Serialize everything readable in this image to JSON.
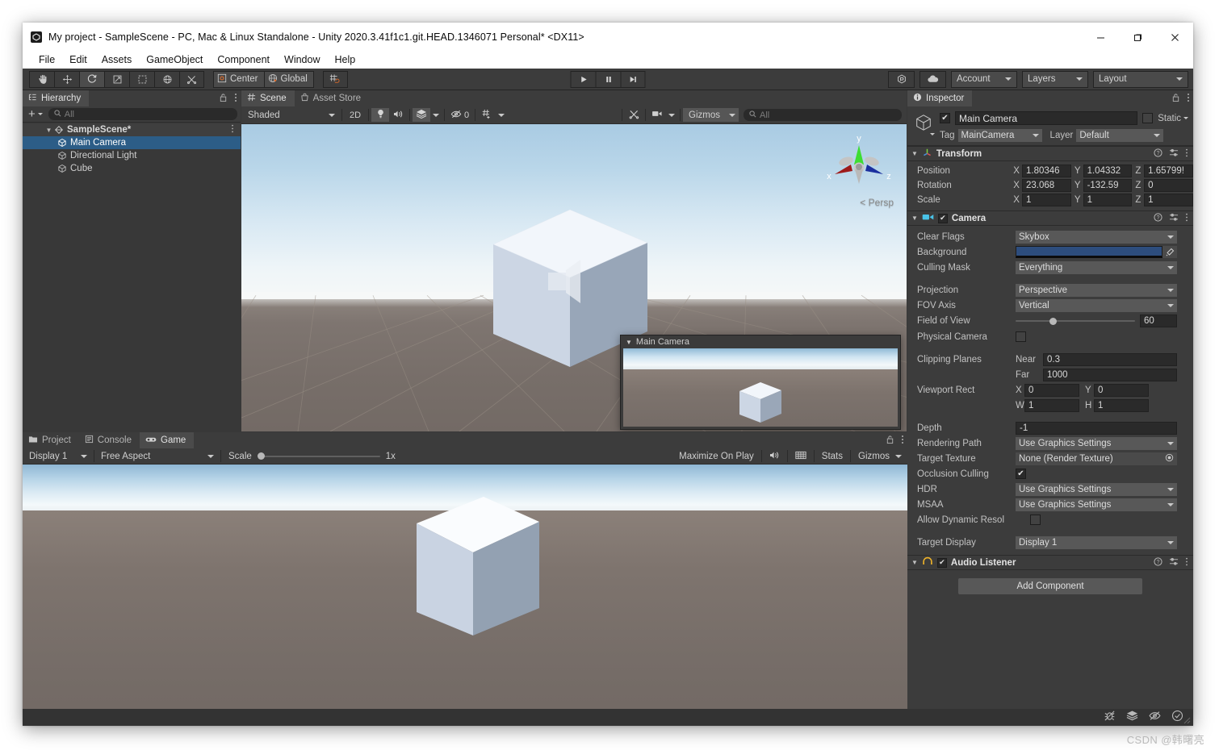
{
  "window": {
    "title": "My project - SampleScene - PC, Mac & Linux Standalone - Unity 2020.3.41f1c1.git.HEAD.1346071 Personal* <DX11>",
    "minimize_label": "Minimize",
    "maximize_label": "Maximize",
    "close_label": "Close"
  },
  "menubar": {
    "items": [
      "File",
      "Edit",
      "Assets",
      "GameObject",
      "Component",
      "Window",
      "Help"
    ]
  },
  "toolbar": {
    "tools": [
      {
        "name": "hand-tool",
        "glyph": "✋"
      },
      {
        "name": "move-tool",
        "glyph": "✥"
      },
      {
        "name": "rotate-tool",
        "glyph": "↺"
      },
      {
        "name": "scale-tool",
        "glyph": "⤢"
      },
      {
        "name": "rect-tool",
        "glyph": "⬚"
      },
      {
        "name": "transform-tool",
        "glyph": "⊕"
      },
      {
        "name": "custom-editor-tool",
        "glyph": "✂"
      }
    ],
    "pivot_label": "Center",
    "handle_label": "Global",
    "grid_snap_label": "Grid Snapping",
    "play_label": "Play",
    "pause_label": "Pause",
    "step_label": "Step",
    "collab_label": "Collab",
    "cloud_label": "Services",
    "account_label": "Account",
    "layers_label": "Layers",
    "layout_label": "Layout"
  },
  "hierarchy": {
    "tab_label": "Hierarchy",
    "add_label": "+",
    "search_placeholder": "All",
    "search_value": "",
    "items": [
      {
        "label": "SampleScene*",
        "depth": 0,
        "type": "scene",
        "expanded": true,
        "selected": false
      },
      {
        "label": "Main Camera",
        "depth": 1,
        "type": "gameobject",
        "selected": true
      },
      {
        "label": "Directional Light",
        "depth": 1,
        "type": "gameobject",
        "selected": false
      },
      {
        "label": "Cube",
        "depth": 1,
        "type": "gameobject",
        "selected": false
      }
    ]
  },
  "scene": {
    "tabs": [
      {
        "label": "Scene",
        "active": true,
        "icon": "grid-icon"
      },
      {
        "label": "Asset Store",
        "active": false,
        "icon": "store-icon"
      }
    ],
    "draw_mode": "Shaded",
    "toggle_2d": "2D",
    "lighting_label": "Lighting",
    "audio_label": "Audio",
    "fx_label": "Effects",
    "hidden_count": "0",
    "grid_label": "Grid",
    "tools_label": "Scene Tools",
    "camera_label": "Scene Camera",
    "gizmos_label": "Gizmos",
    "search_placeholder": "All",
    "search_value": "",
    "persp_label": "< Persp",
    "axis_labels": {
      "x": "x",
      "y": "y",
      "z": "z"
    },
    "preview_title": "Main Camera"
  },
  "game": {
    "tabs": [
      {
        "label": "Project",
        "active": false,
        "icon": "folder-icon"
      },
      {
        "label": "Console",
        "active": false,
        "icon": "console-icon"
      },
      {
        "label": "Game",
        "active": true,
        "icon": "gamepad-icon"
      }
    ],
    "display": "Display 1",
    "aspect": "Free Aspect",
    "scale_label": "Scale",
    "scale_value": "1x",
    "maximize_label": "Maximize On Play",
    "mute_label": "Mute Audio",
    "stats_label": "Stats",
    "gizmos_label": "Gizmos"
  },
  "inspector": {
    "tab_label": "Inspector",
    "object_name": "Main Camera",
    "object_enabled": true,
    "static_label": "Static",
    "static_checked": false,
    "tag_label": "Tag",
    "tag_value": "MainCamera",
    "layer_label": "Layer",
    "layer_value": "Default",
    "components": [
      {
        "name": "Transform",
        "icon": "transform-icon",
        "has_toggle": false,
        "enabled": true,
        "rows": [
          {
            "label": "Position",
            "type": "vec3",
            "x": "1.80346",
            "y": "1.04332",
            "z": "1.65799!"
          },
          {
            "label": "Rotation",
            "type": "vec3",
            "x": "23.068",
            "y": "-132.59",
            "z": "0"
          },
          {
            "label": "Scale",
            "type": "vec3",
            "x": "1",
            "y": "1",
            "z": "1"
          }
        ]
      },
      {
        "name": "Camera",
        "icon": "camera-icon",
        "has_toggle": true,
        "enabled": true,
        "rows": [
          {
            "label": "Clear Flags",
            "type": "dropdown",
            "value": "Skybox"
          },
          {
            "label": "Background",
            "type": "color",
            "value": "#2d4d7d"
          },
          {
            "label": "Culling Mask",
            "type": "dropdown",
            "value": "Everything"
          },
          {
            "label": "",
            "type": "spacer"
          },
          {
            "label": "Projection",
            "type": "dropdown",
            "value": "Perspective"
          },
          {
            "label": "FOV Axis",
            "type": "dropdown",
            "value": "Vertical"
          },
          {
            "label": "Field of View",
            "type": "slider",
            "value": "60",
            "min": 1,
            "max": 179
          },
          {
            "label": "Physical Camera",
            "type": "checkbox",
            "checked": false
          },
          {
            "label": "",
            "type": "spacer"
          },
          {
            "label": "Clipping Planes",
            "type": "labeled-field",
            "sub_label": "Near",
            "value": "0.3"
          },
          {
            "label": "",
            "type": "labeled-field",
            "sub_label": "Far",
            "value": "1000"
          },
          {
            "label": "Viewport Rect",
            "type": "vec2",
            "a_label": "X",
            "a": "0",
            "b_label": "Y",
            "b": "0"
          },
          {
            "label": "",
            "type": "vec2",
            "a_label": "W",
            "a": "1",
            "b_label": "H",
            "b": "1"
          },
          {
            "label": "",
            "type": "spacer"
          },
          {
            "label": "Depth",
            "type": "field",
            "value": "-1"
          },
          {
            "label": "Rendering Path",
            "type": "dropdown",
            "value": "Use Graphics Settings"
          },
          {
            "label": "Target Texture",
            "type": "object",
            "value": "None (Render Texture)"
          },
          {
            "label": "Occlusion Culling",
            "type": "checkbox",
            "checked": true
          },
          {
            "label": "HDR",
            "type": "dropdown",
            "value": "Use Graphics Settings"
          },
          {
            "label": "MSAA",
            "type": "dropdown",
            "value": "Use Graphics Settings"
          },
          {
            "label": "Allow Dynamic Resol",
            "type": "checkbox",
            "checked": false
          },
          {
            "label": "",
            "type": "spacer"
          },
          {
            "label": "Target Display",
            "type": "dropdown",
            "value": "Display 1"
          }
        ]
      },
      {
        "name": "Audio Listener",
        "icon": "audio-icon",
        "has_toggle": true,
        "enabled": true,
        "rows": []
      }
    ],
    "add_component_label": "Add Component"
  },
  "statusbar": {
    "icons": [
      "bug-icon",
      "layers-icon",
      "eye-off-icon",
      "check-circle-icon"
    ]
  },
  "watermark": "CSDN @韩曙亮",
  "colors": {
    "accent_selection": "#2c5d87",
    "panel_bg": "#383838",
    "panel_header": "#3c3c3c",
    "field_bg": "#2a2a2a",
    "dropdown_bg": "#585858",
    "camera_background": "#2d4d7d",
    "ground": "#736a65",
    "sky_top": "#a9cbe3"
  }
}
